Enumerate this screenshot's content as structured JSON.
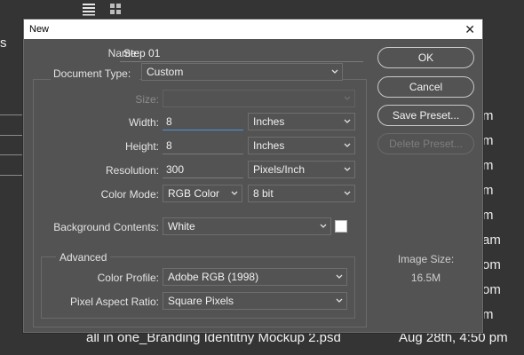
{
  "background": {
    "edge_char": "s",
    "times": [
      "m",
      "m",
      "m",
      "m",
      "m",
      "m",
      "m",
      "am",
      "am",
      "om",
      "om",
      "m"
    ],
    "bottom_file": "all in one_Branding Identitny Mockup 2.psd",
    "bottom_date": "Aug 28th, 4:50 pm"
  },
  "dialog": {
    "title": "New",
    "name_label": "Name:",
    "name_value": "Step 01",
    "doc_type_label": "Document Type:",
    "doc_type_value": "Custom",
    "size_label": "Size:",
    "size_value": "",
    "width_label": "Width:",
    "width_value": "8",
    "width_unit": "Inches",
    "height_label": "Height:",
    "height_value": "8",
    "height_unit": "Inches",
    "resolution_label": "Resolution:",
    "resolution_value": "300",
    "resolution_unit": "Pixels/Inch",
    "color_mode_label": "Color Mode:",
    "color_mode_value": "RGB Color",
    "bit_depth_value": "8 bit",
    "bg_contents_label": "Background Contents:",
    "bg_contents_value": "White",
    "bg_swatch_color": "#ffffff",
    "advanced_label": "Advanced",
    "color_profile_label": "Color Profile:",
    "color_profile_value": "Adobe RGB (1998)",
    "pixel_aspect_label": "Pixel Aspect Ratio:",
    "pixel_aspect_value": "Square Pixels",
    "ok_label": "OK",
    "cancel_label": "Cancel",
    "save_preset_label": "Save Preset...",
    "delete_preset_label": "Delete Preset...",
    "image_size_label": "Image Size:",
    "image_size_value": "16.5M"
  }
}
